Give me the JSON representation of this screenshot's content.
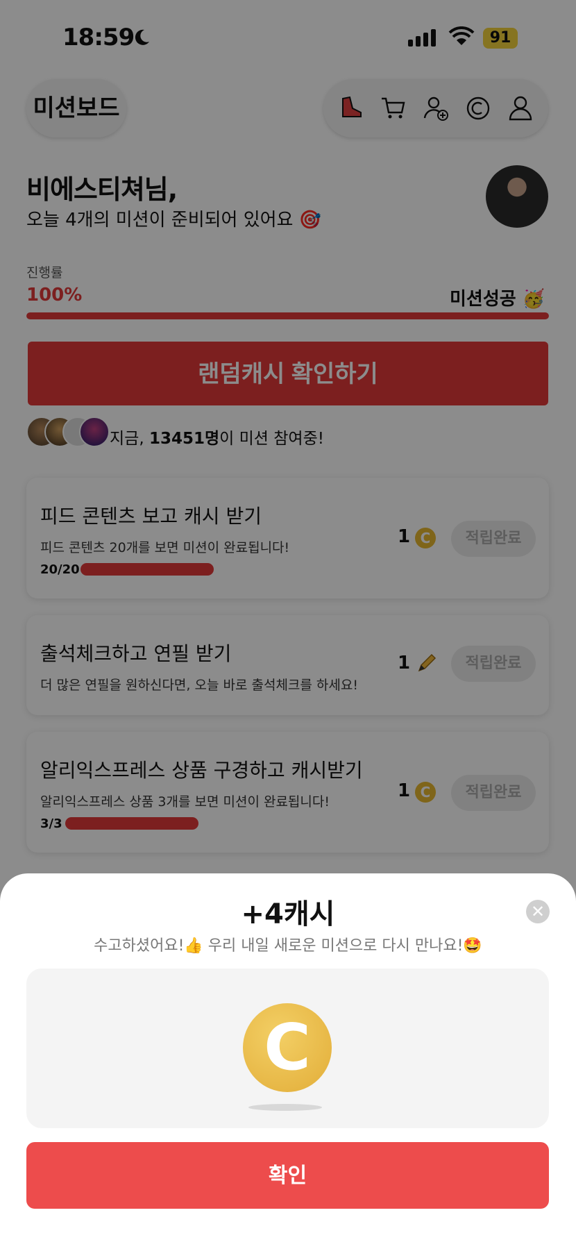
{
  "status_bar": {
    "time": "18:59",
    "battery": "91"
  },
  "header": {
    "title": "미션보드",
    "icons": [
      "shoe-icon",
      "cart-icon",
      "add-friend-icon",
      "cash-icon",
      "profile-icon"
    ]
  },
  "greeting": {
    "name": "비에스티쳐님,",
    "subtitle": "오늘 4개의 미션이 준비되어 있어요 🎯"
  },
  "progress": {
    "label": "진행률",
    "value_text": "100%",
    "value": 1.0,
    "success_text": "미션성공 🥳",
    "color": "#e23a3a"
  },
  "random_button": {
    "label": "랜덤캐시 확인하기"
  },
  "participants": {
    "prefix": "지금, ",
    "count": "13451명",
    "suffix": "이 미션 참여중!"
  },
  "missions": [
    {
      "title": "피드 콘텐츠 보고 캐시 받기",
      "desc": "피드 콘텐츠 20개를 보면 미션이 완료됩니다!",
      "progress_text": "20/20",
      "progress": 1.0,
      "reward": "1",
      "reward_icon": "cash-coin-icon",
      "button": "적립완료"
    },
    {
      "title": "출석체크하고 연필 받기",
      "desc": "더 많은 연필을 원하신다면, 오늘 바로 출석체크를 하세요!",
      "reward": "1",
      "reward_icon": "pencil-icon",
      "button": "적립완료"
    },
    {
      "title": "알리익스프레스 상품 구경하고 캐시받기",
      "desc": "알리익스프레스 상품 3개를 보면 미션이 완료됩니다!",
      "progress_text": "3/3",
      "progress": 1.0,
      "reward": "1",
      "reward_icon": "cash-coin-icon",
      "button": "적립완료"
    }
  ],
  "sheet": {
    "title": "+4캐시",
    "subtitle": "수고하셨어요!👍 우리 내일 새로운 미션으로 다시 만나요!🤩",
    "coin_letter": "C",
    "confirm": "확인"
  }
}
